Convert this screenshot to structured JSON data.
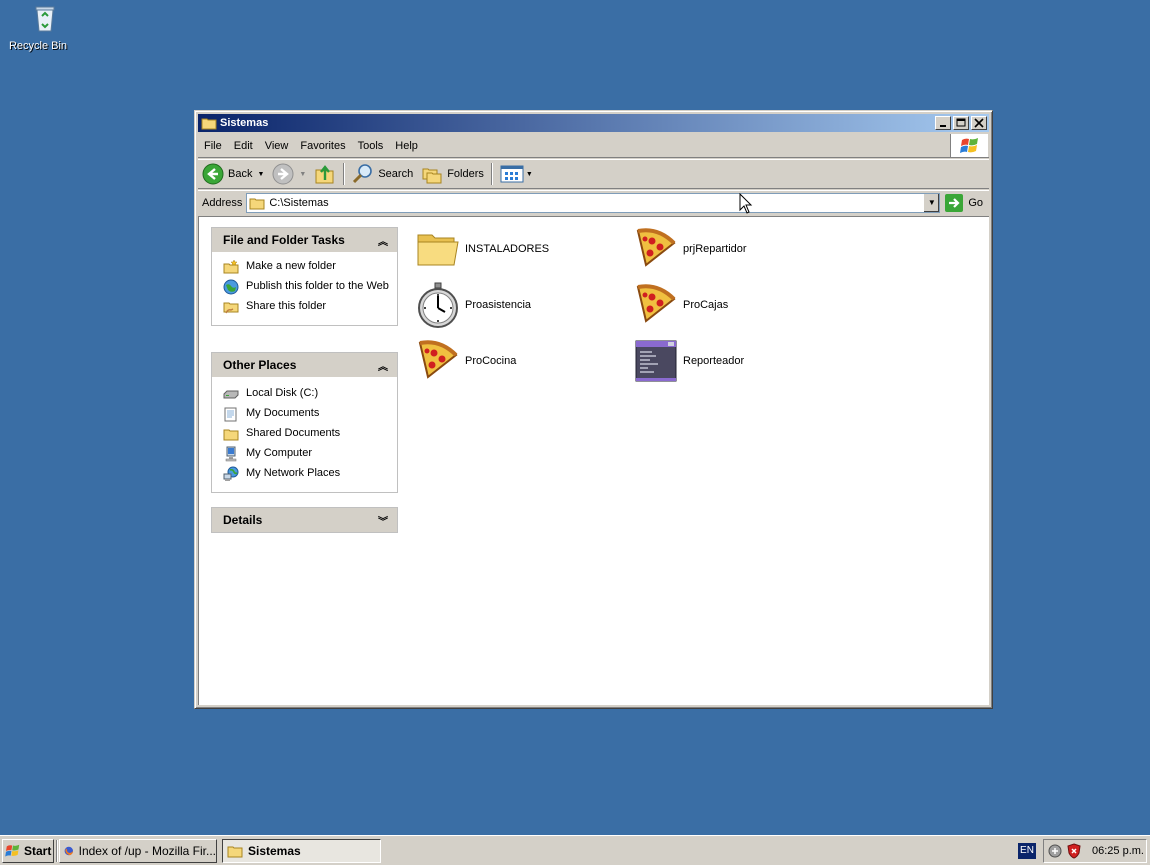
{
  "desktop": {
    "icons": [
      {
        "label": "Recycle Bin",
        "icon": "recycle-bin-icon"
      }
    ]
  },
  "window": {
    "title": "Sistemas",
    "controls": {
      "minimize": "_",
      "maximize": "□",
      "close": "X"
    },
    "menu": [
      "File",
      "Edit",
      "View",
      "Favorites",
      "Tools",
      "Help"
    ],
    "toolbar": {
      "back": "Back",
      "search": "Search",
      "folders": "Folders"
    },
    "address": {
      "label": "Address",
      "value": "C:\\Sistemas",
      "go": "Go"
    },
    "sidebar": {
      "tasks": {
        "title": "File and Folder Tasks",
        "items": [
          {
            "label": "Make a new folder",
            "icon": "new-folder-icon"
          },
          {
            "label": "Publish this folder to the Web",
            "icon": "publish-web-icon"
          },
          {
            "label": "Share this folder",
            "icon": "share-folder-icon"
          }
        ]
      },
      "places": {
        "title": "Other Places",
        "items": [
          {
            "label": "Local Disk (C:)",
            "icon": "local-disk-icon"
          },
          {
            "label": "My Documents",
            "icon": "my-documents-icon"
          },
          {
            "label": "Shared Documents",
            "icon": "shared-documents-icon"
          },
          {
            "label": "My Computer",
            "icon": "my-computer-icon"
          },
          {
            "label": "My Network Places",
            "icon": "network-places-icon"
          }
        ]
      },
      "details": {
        "title": "Details"
      }
    },
    "files": [
      {
        "label": "INSTALADORES",
        "icon": "folder-icon"
      },
      {
        "label": "prjRepartidor",
        "icon": "pizza-icon"
      },
      {
        "label": "Proasistencia",
        "icon": "stopwatch-icon"
      },
      {
        "label": "ProCajas",
        "icon": "pizza-icon"
      },
      {
        "label": "ProCocina",
        "icon": "pizza-icon"
      },
      {
        "label": "Reporteador",
        "icon": "console-app-icon"
      }
    ]
  },
  "taskbar": {
    "start": "Start",
    "tasks": [
      {
        "label": "Index of /up - Mozilla Fir...",
        "icon": "firefox-icon",
        "active": false
      },
      {
        "label": "Sistemas",
        "icon": "folder-icon",
        "active": true
      }
    ],
    "language": "EN",
    "clock": "06:25 p.m."
  },
  "colors": {
    "desktop": "#3a6ea5",
    "titlebar_start": "#0a246a",
    "titlebar_end": "#a6caf0",
    "chrome": "#d4d0c8"
  }
}
